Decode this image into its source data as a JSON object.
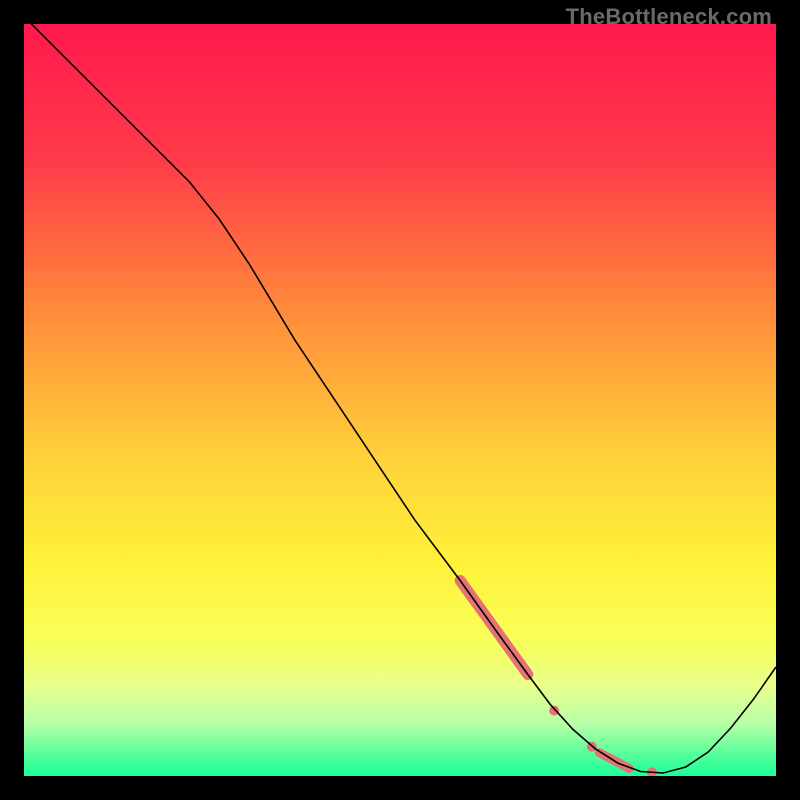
{
  "watermark": "TheBottleneck.com",
  "gradient_stops": [
    {
      "offset": 0.0,
      "color": "#ff1a4d"
    },
    {
      "offset": 0.18,
      "color": "#ff3a4a"
    },
    {
      "offset": 0.38,
      "color": "#ff8a3a"
    },
    {
      "offset": 0.58,
      "color": "#ffd23a"
    },
    {
      "offset": 0.72,
      "color": "#fff23a"
    },
    {
      "offset": 0.82,
      "color": "#f8ff5a"
    },
    {
      "offset": 0.88,
      "color": "#e8ff8a"
    },
    {
      "offset": 0.93,
      "color": "#b8ffa8"
    },
    {
      "offset": 0.97,
      "color": "#5aff9a"
    },
    {
      "offset": 1.0,
      "color": "#1aff9a"
    }
  ],
  "chart_data": {
    "type": "line",
    "title": "",
    "xlabel": "",
    "ylabel": "",
    "xlim": [
      0,
      100
    ],
    "ylim": [
      0,
      100
    ],
    "series": [
      {
        "name": "curve",
        "color": "#000000",
        "width": 1.6,
        "points": [
          {
            "x": 0,
            "y": 101
          },
          {
            "x": 8,
            "y": 93
          },
          {
            "x": 16,
            "y": 85
          },
          {
            "x": 22,
            "y": 79
          },
          {
            "x": 26,
            "y": 74
          },
          {
            "x": 30,
            "y": 68
          },
          {
            "x": 36,
            "y": 58
          },
          {
            "x": 44,
            "y": 46
          },
          {
            "x": 52,
            "y": 34
          },
          {
            "x": 58,
            "y": 26
          },
          {
            "x": 63,
            "y": 19
          },
          {
            "x": 67,
            "y": 13.5
          },
          {
            "x": 70,
            "y": 9.5
          },
          {
            "x": 73,
            "y": 6.2
          },
          {
            "x": 76,
            "y": 3.6
          },
          {
            "x": 79,
            "y": 1.7
          },
          {
            "x": 82,
            "y": 0.6
          },
          {
            "x": 85,
            "y": 0.4
          },
          {
            "x": 88,
            "y": 1.2
          },
          {
            "x": 91,
            "y": 3.2
          },
          {
            "x": 94,
            "y": 6.4
          },
          {
            "x": 97,
            "y": 10.2
          },
          {
            "x": 100,
            "y": 14.5
          }
        ]
      }
    ],
    "markers": [
      {
        "name": "highlight-band",
        "color": "#e57373",
        "type": "thick-segment",
        "width": 11,
        "points": [
          {
            "x": 58,
            "y": 26
          },
          {
            "x": 67,
            "y": 13.5
          }
        ]
      },
      {
        "name": "dot-mid",
        "color": "#e57373",
        "type": "dot",
        "r": 5,
        "points": [
          {
            "x": 70.5,
            "y": 8.7
          }
        ]
      },
      {
        "name": "dot-low-1",
        "color": "#e57373",
        "type": "dot",
        "r": 5,
        "points": [
          {
            "x": 75.5,
            "y": 3.9
          }
        ]
      },
      {
        "name": "dot-low-band",
        "color": "#e57373",
        "type": "thick-segment",
        "width": 9,
        "points": [
          {
            "x": 76.5,
            "y": 3.1
          },
          {
            "x": 80.5,
            "y": 1.0
          }
        ]
      },
      {
        "name": "dot-low-3",
        "color": "#e57373",
        "type": "dot",
        "r": 5,
        "points": [
          {
            "x": 83.5,
            "y": 0.5
          }
        ]
      }
    ]
  }
}
